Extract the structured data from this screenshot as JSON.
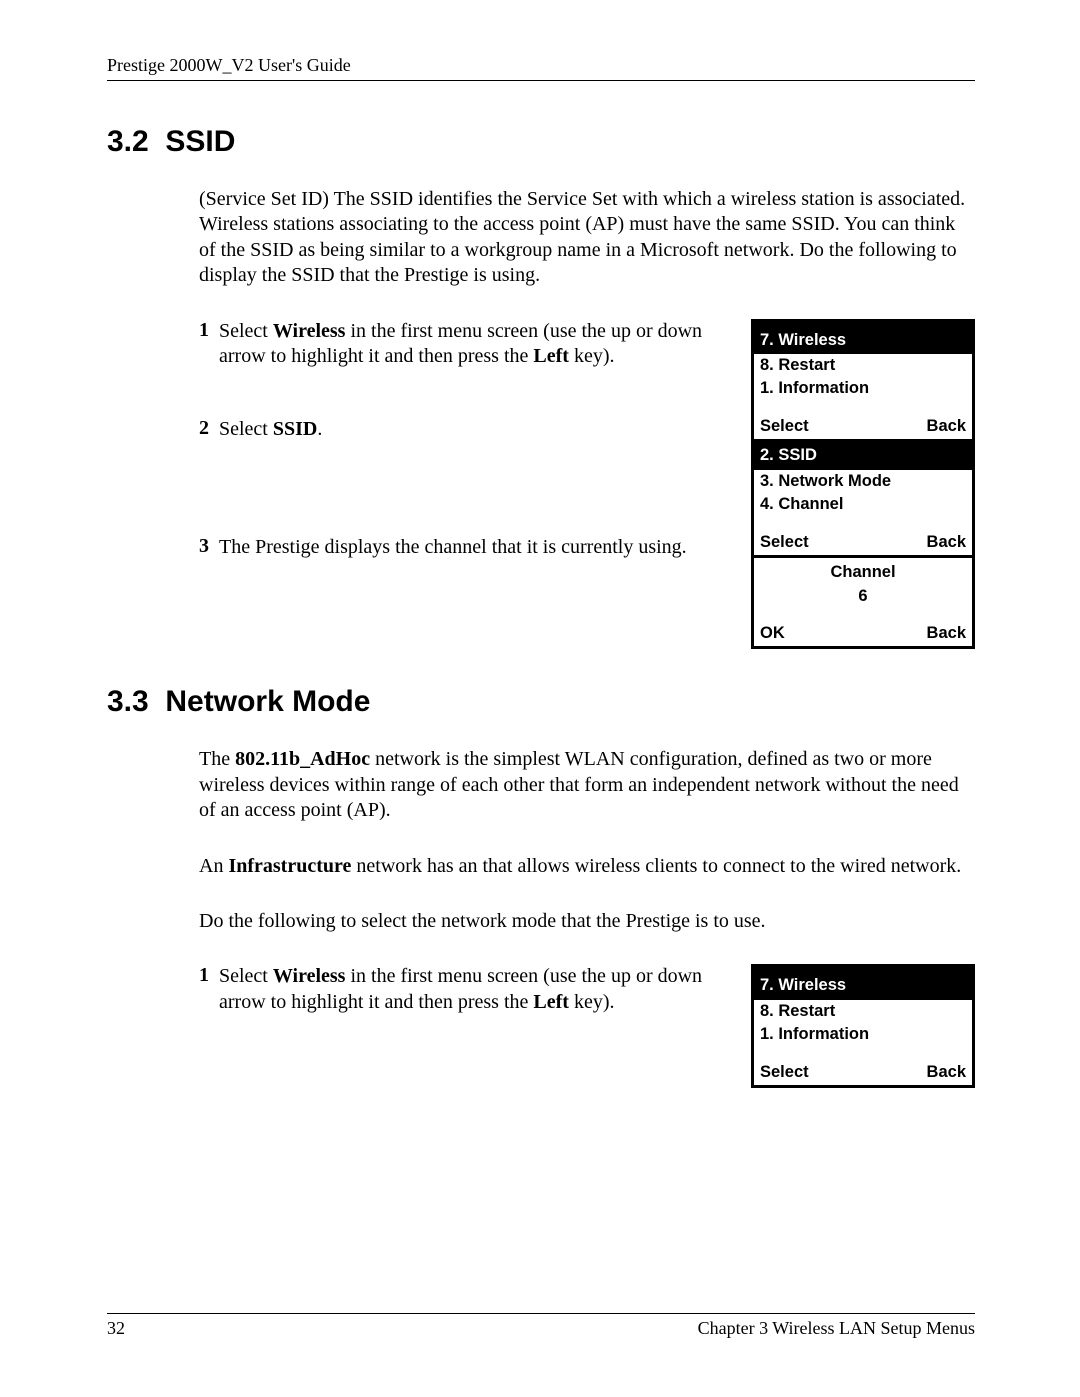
{
  "header": {
    "document_title": "Prestige 2000W_V2 User's Guide"
  },
  "section32": {
    "number": "3.2",
    "title": "SSID",
    "intro": "(Service Set ID) The SSID identifies the Service Set with which a wireless station is associated. Wireless stations associating to the access point (AP) must have the same SSID. You can think of the SSID as being similar to a workgroup name in a Microsoft network. Do the following to display the SSID that the Prestige is using.",
    "steps": {
      "s1": {
        "num": "1",
        "pre": "Select ",
        "b1": "Wireless",
        "mid": " in the first menu screen (use the up or down arrow to highlight it and then press the ",
        "b2": "Left",
        "post": " key)."
      },
      "s2": {
        "num": "2",
        "pre": "Select ",
        "b1": "SSID",
        "post": "."
      },
      "s3": {
        "num": "3",
        "text": "The Prestige displays the channel that it is currently using."
      }
    },
    "screen1": {
      "sel": "7. Wireless",
      "l1": "8. Restart",
      "l2": "1. Information",
      "left": "Select",
      "right": "Back"
    },
    "screen2": {
      "sel": "2. SSID",
      "l1": "3. Network Mode",
      "l2": "4. Channel",
      "left": "Select",
      "right": "Back"
    },
    "screen3": {
      "title": "Channel",
      "value": "6",
      "left": "OK",
      "right": "Back"
    }
  },
  "section33": {
    "number": "3.3",
    "title": "Network Mode",
    "p1": {
      "pre": "The  ",
      "b": "802.11b_AdHoc",
      "post": " network is the simplest WLAN configuration, defined as two or more wireless devices within range of each other that form an independent network without the need of an access point (AP)."
    },
    "p2": {
      "pre": "An ",
      "b": "Infrastructure",
      "post": " network has an that allows wireless clients to connect to the wired network."
    },
    "p3": "Do the following to select the network mode that the Prestige is to use.",
    "steps": {
      "s1": {
        "num": "1",
        "pre": "Select ",
        "b1": "Wireless",
        "mid": " in the first menu screen (use the up or down arrow to highlight it and then press the ",
        "b2": "Left",
        "post": " key)."
      }
    },
    "screen1": {
      "sel": "7. Wireless",
      "l1": "8. Restart",
      "l2": "1. Information",
      "left": "Select",
      "right": "Back"
    }
  },
  "footer": {
    "page": "32",
    "chapter": "Chapter 3 Wireless LAN Setup Menus"
  }
}
